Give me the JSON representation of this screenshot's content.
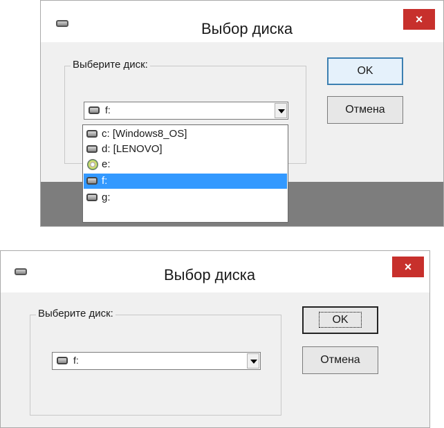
{
  "dialog_expanded": {
    "title": "Выбор диска",
    "close_label": "×",
    "group_label": "Выберите диск:",
    "selected_drive": "f:",
    "ok_label": "OK",
    "cancel_label": "Отмена",
    "drives": [
      {
        "label": "c: [Windows8_OS]",
        "icon": "hard-drive-icon"
      },
      {
        "label": "d: [LENOVO]",
        "icon": "hard-drive-icon"
      },
      {
        "label": "e:",
        "icon": "cd-drive-icon"
      },
      {
        "label": "f:",
        "icon": "hard-drive-icon",
        "selected": true
      },
      {
        "label": "g:",
        "icon": "hard-drive-icon"
      }
    ]
  },
  "dialog_collapsed": {
    "title": "Выбор диска",
    "close_label": "×",
    "group_label": "Выберите диск:",
    "selected_drive": "f:",
    "ok_label": "OK",
    "cancel_label": "Отмена"
  },
  "colors": {
    "close_button": "#c7302c",
    "selection": "#3399ff",
    "dialog_bg": "#f0f0f0"
  }
}
